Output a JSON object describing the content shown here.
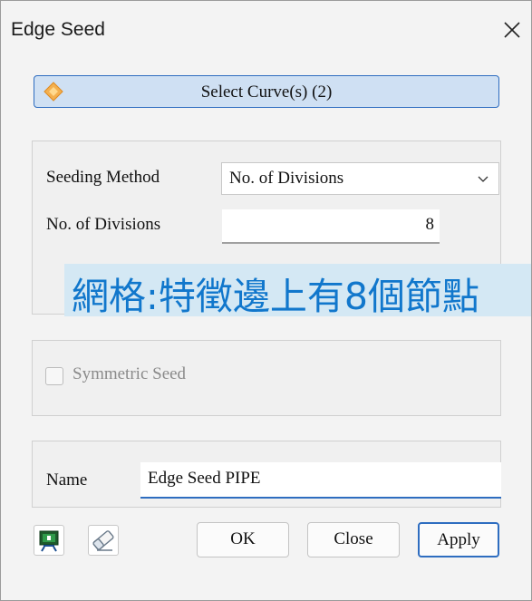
{
  "window": {
    "title": "Edge Seed"
  },
  "select_curves": {
    "label": "Select Curve(s) (2)"
  },
  "seeding": {
    "method_label": "Seeding Method",
    "method_value": "No. of Divisions",
    "divisions_label": "No. of Divisions",
    "divisions_value": "8"
  },
  "overlay_caption": "網格:特徵邊上有8個節點",
  "symmetric": {
    "label": "Symmetric Seed",
    "checked": false
  },
  "name": {
    "label": "Name",
    "value": "Edge Seed PIPE"
  },
  "buttons": {
    "ok": "OK",
    "close": "Close",
    "apply": "Apply"
  },
  "icons": {
    "close": "close-icon",
    "select": "diamond-select-icon",
    "dropdown": "chevron-down-icon",
    "preview": "preview-icon",
    "eraser": "eraser-icon"
  },
  "colors": {
    "accent": "#2e6dc0",
    "select_fill": "#cfe0f3",
    "overlay_bg": "#d4e8f4",
    "overlay_text": "#1177cc"
  }
}
